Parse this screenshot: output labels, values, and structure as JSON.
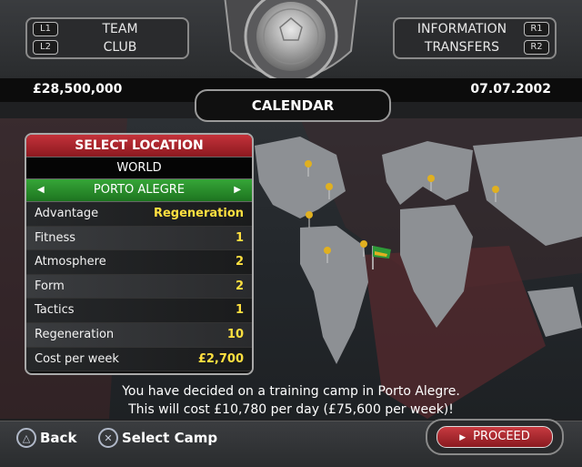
{
  "nav": {
    "left": [
      {
        "button": "L1",
        "label": "TEAM"
      },
      {
        "button": "L2",
        "label": "CLUB"
      }
    ],
    "right": [
      {
        "button": "R1",
        "label": "INFORMATION"
      },
      {
        "button": "R2",
        "label": "TRANSFERS"
      }
    ]
  },
  "header": {
    "money": "£28,500,000",
    "date": "07.07.2002",
    "title": "CALENDAR"
  },
  "location_panel": {
    "title": "SELECT LOCATION",
    "region": "WORLD",
    "location": "PORTO ALEGRE",
    "rows": [
      {
        "label": "Advantage",
        "value": "Regeneration"
      },
      {
        "label": "Fitness",
        "value": "1"
      },
      {
        "label": "Atmosphere",
        "value": "2"
      },
      {
        "label": "Form",
        "value": "2"
      },
      {
        "label": "Tactics",
        "value": "1"
      },
      {
        "label": "Regeneration",
        "value": "10"
      },
      {
        "label": "Cost per week",
        "value": "£2,700"
      }
    ]
  },
  "message": {
    "line1": "You have decided on a training camp in Porto Alegre.",
    "line2": "This will cost £10,780 per day (£75,600 per week)!"
  },
  "footer": {
    "back_label": "Back",
    "select_label": "Select Camp",
    "proceed_label": "PROCEED"
  },
  "colors": {
    "header_red": "#c4323a",
    "location_green": "#36a638",
    "value_yellow": "#ffe040",
    "map_red": "#5a2a2e"
  },
  "icons": {
    "back_button": "triangle-icon",
    "select_button": "cross-icon",
    "proceed": "play-icon"
  }
}
